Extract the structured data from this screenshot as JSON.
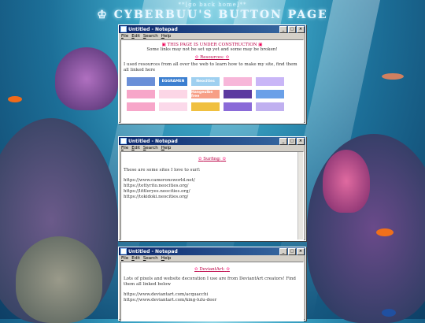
{
  "header": {
    "back_link": "**[go back home]**",
    "title": "CYBERBUU'S BUTTON PAGE",
    "title_icon": "♔"
  },
  "windows": [
    {
      "title": "Untitled - Notepad",
      "menu": [
        "File",
        "Edit",
        "Search",
        "Help"
      ],
      "notice": "THIS PAGE IS UNDER CONSTRUCTION",
      "notice_sub": "Some links may not be set up yet and some may be broken!",
      "section": "Resources:",
      "body": "I used resources from all over the web to learn how to make my site, find them all linked here",
      "buttons": [
        {
          "label": "",
          "bg": "#6a8fd8"
        },
        {
          "label": "EGGRAMEN",
          "bg": "#3c7fd0"
        },
        {
          "label": "Neocities",
          "bg": "#9fd0f0"
        },
        {
          "label": "",
          "bg": "#f7b6d9"
        },
        {
          "label": "",
          "bg": "#c9b6f7"
        },
        {
          "label": "",
          "bg": "#f7a6c9"
        },
        {
          "label": "",
          "bg": "#fcd6e6"
        },
        {
          "label": "Hangeulbe free",
          "bg": "#f79f86"
        },
        {
          "label": "",
          "bg": "#5b3aa0"
        },
        {
          "label": "",
          "bg": "#6aa0e8"
        },
        {
          "label": "",
          "bg": "#f7a6c9"
        },
        {
          "label": "",
          "bg": "#fbd9ea"
        },
        {
          "label": "",
          "bg": "#f0c040"
        },
        {
          "label": "",
          "bg": "#8a6ad8"
        },
        {
          "label": "",
          "bg": "#c0b0f0"
        }
      ]
    },
    {
      "title": "Untitled - Notepad",
      "menu": [
        "File",
        "Edit",
        "Search",
        "Help"
      ],
      "section": "Surfing:",
      "intro": "These are some sites I love to surf:",
      "links": [
        "https://www.cameronsworld.net/",
        "https://tettyrito.neocities.org/",
        "https://littleryes.neocities.org/",
        "https://tokidoki.neocities.org/"
      ]
    },
    {
      "title": "Untitled - Notepad",
      "menu": [
        "File",
        "Edit",
        "Search",
        "Help"
      ],
      "section": "DeviantArt:",
      "intro": "Lots of pixels and website decoration I use are from DeviantArt creators! Find them all linked below",
      "links": [
        "https://www.deviantart.com/acquacchi",
        "https://www.deviantart.com/king-lulu-deer"
      ]
    }
  ]
}
